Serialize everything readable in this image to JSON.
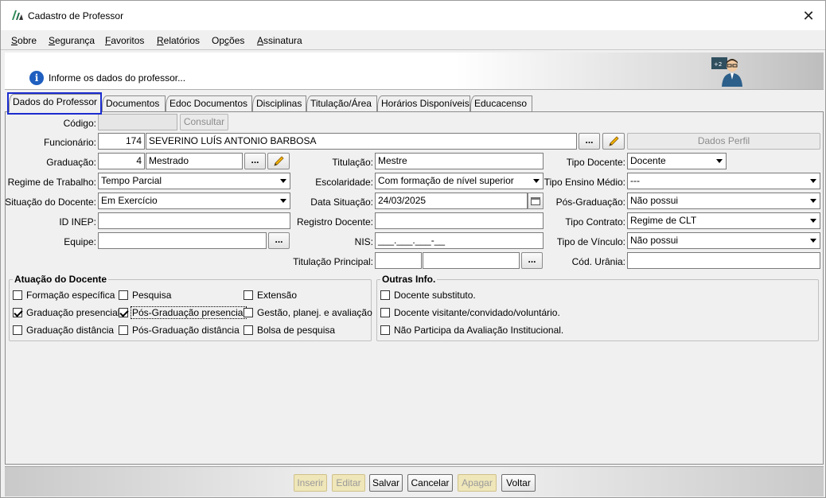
{
  "window": {
    "title": "Cadastro de Professor",
    "close": "✕"
  },
  "menu": [
    {
      "pre": "",
      "accel": "S",
      "post": "obre"
    },
    {
      "pre": "",
      "accel": "S",
      "post": "egurança"
    },
    {
      "pre": "",
      "accel": "F",
      "post": "avoritos"
    },
    {
      "pre": "",
      "accel": "R",
      "post": "elatórios"
    },
    {
      "pre": "Op",
      "accel": "ç",
      "post": "ões"
    },
    {
      "pre": "",
      "accel": "A",
      "post": "ssinatura"
    }
  ],
  "header": {
    "info_text": "Informe os dados do professor..."
  },
  "tabs": [
    "Dados do Professor",
    "Documentos",
    "Edoc Documentos",
    "Disciplinas",
    "Titulação/Área",
    "Horários Disponíveis",
    "Educacenso"
  ],
  "form": {
    "codigo_label": "Código:",
    "codigo_value": "",
    "consultar": "Consultar",
    "funcionario_label": "Funcionário:",
    "funcionario_id": "174",
    "funcionario_nome": "SEVERINO LUÍS ANTONIO BARBOSA",
    "dots": "...",
    "dados_perfil": "Dados Perfil",
    "graduacao_label": "Graduação:",
    "graduacao_id": "4",
    "graduacao_nome": "Mestrado",
    "titulacao_label": "Titulação:",
    "titulacao_value": "Mestre",
    "tipo_docente_label": "Tipo Docente:",
    "tipo_docente_value": "Docente",
    "regime_label": "Regime de Trabalho:",
    "regime_value": "Tempo Parcial",
    "escolaridade_label": "Escolaridade:",
    "escolaridade_value": "Com formação de nível superior",
    "tipo_ensino_label": "Tipo Ensino Médio:",
    "tipo_ensino_value": "---",
    "situacao_label": "Situação do Docente:",
    "situacao_value": "Em Exercício",
    "data_situacao_label": "Data Situação:",
    "data_situacao_value": "24/03/2025",
    "pos_label": "Pós-Graduação:",
    "pos_value": "Não possui",
    "inep_label": "ID INEP:",
    "inep_value": "",
    "registro_label": "Registro Docente:",
    "registro_value": "",
    "tipo_contrato_label": "Tipo Contrato:",
    "tipo_contrato_value": "Regime de CLT",
    "equipe_label": "Equipe:",
    "equipe_value": "",
    "nis_label": "NIS:",
    "nis_value": "___.___.___-__",
    "tipo_vinculo_label": "Tipo de Vínculo:",
    "tipo_vinculo_value": "Não possui",
    "titulacao_principal_label": "Titulação Principal:",
    "cod_urania_label": "Cód. Urânia:",
    "cod_urania_value": ""
  },
  "atuacao": {
    "title": "Atuação do Docente",
    "items": [
      {
        "label": "Formação específica",
        "checked": false
      },
      {
        "label": "Pesquisa",
        "checked": false
      },
      {
        "label": "Extensão",
        "checked": false
      },
      {
        "label": "Graduação presencial",
        "checked": true
      },
      {
        "label": "Pós-Graduação presencial",
        "checked": true
      },
      {
        "label": "Gestão, planej. e avaliação",
        "checked": false
      },
      {
        "label": "Graduação distância",
        "checked": false
      },
      {
        "label": "Pós-Graduação distância",
        "checked": false
      },
      {
        "label": "Bolsa de pesquisa",
        "checked": false
      }
    ]
  },
  "outras": {
    "title": "Outras Info.",
    "items": [
      {
        "label": "Docente substituto.",
        "checked": false
      },
      {
        "label": "Docente visitante/convidado/voluntário.",
        "checked": false
      },
      {
        "label": "Não Participa da Avaliação Institucional.",
        "checked": false
      }
    ]
  },
  "footer": {
    "inserir": "Inserir",
    "editar": "Editar",
    "salvar": "Salvar",
    "cancelar": "Cancelar",
    "apagar": "Apagar",
    "voltar": "Voltar"
  }
}
